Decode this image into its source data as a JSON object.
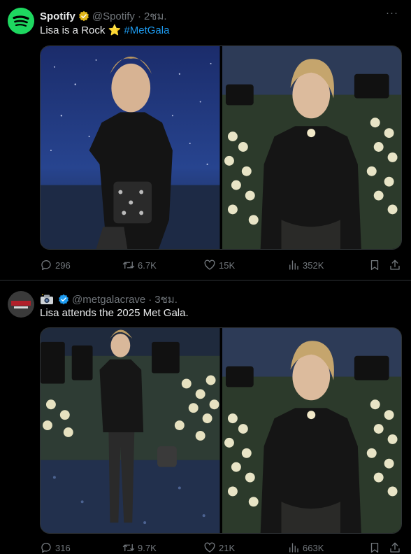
{
  "tweets": [
    {
      "author_name": "Spotify",
      "handle": "@Spotify",
      "separator": "·",
      "time": "2ชม.",
      "more": "···",
      "text": "Lisa is a Rock",
      "emoji": "⭐",
      "hashtag": "#MetGala",
      "reply_count": "296",
      "retweet_count": "6.7K",
      "like_count": "15K",
      "view_count": "352K"
    },
    {
      "handle": "@metgalacrave",
      "separator": "·",
      "time": "3ชม.",
      "text": "Lisa attends the 2025 Met Gala.",
      "reply_count": "316",
      "retweet_count": "9.7K",
      "like_count": "21K",
      "view_count": "663K"
    }
  ],
  "colors": {
    "background": "#000000",
    "text": "#e7e9ea",
    "muted": "#71767b",
    "link": "#1d9bf0",
    "spotify_green": "#1ed760",
    "gold_badge": "#e2b719",
    "blue_badge": "#1d9bf0"
  },
  "icons": [
    "spotify-logo-icon",
    "gold-verified-icon",
    "blue-verified-icon",
    "reply-icon",
    "retweet-icon",
    "like-icon",
    "views-icon",
    "bookmark-icon",
    "share-icon",
    "camera-icon"
  ]
}
